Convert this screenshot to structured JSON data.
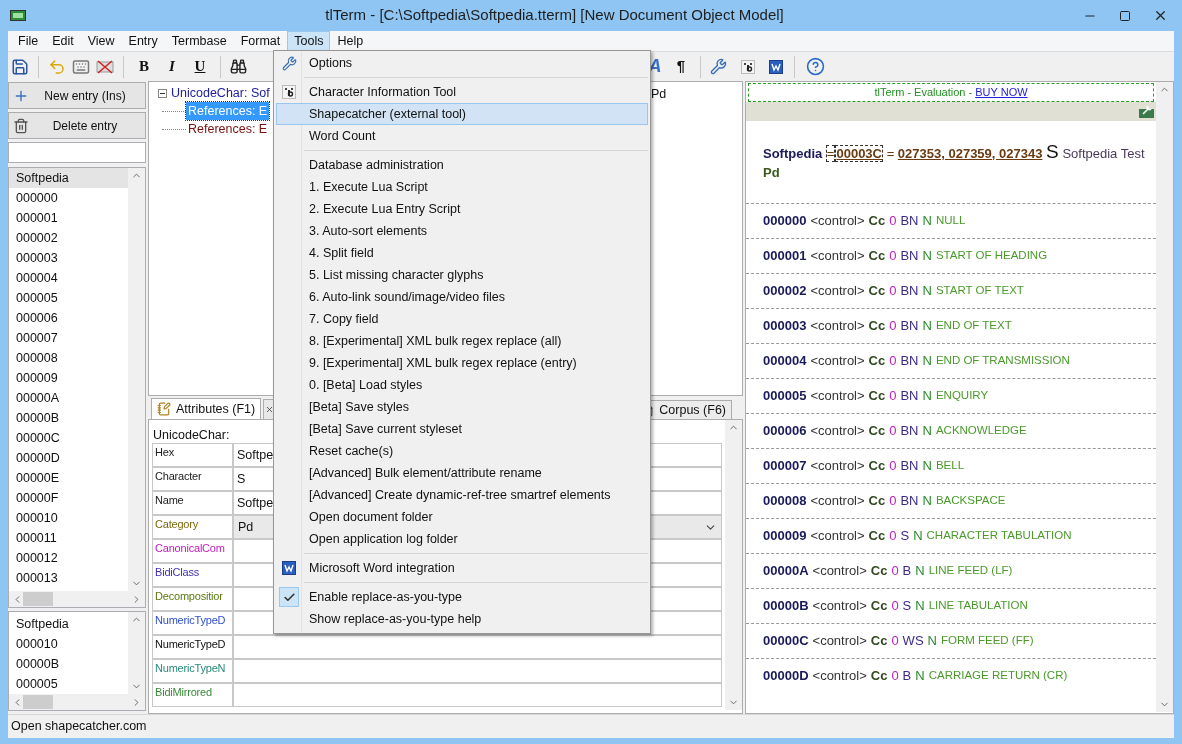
{
  "window": {
    "title": "tlTerm - [C:\\Softpedia\\Softpedia.tterm] [New Document Object Model]"
  },
  "menu_bar": [
    {
      "label": "File",
      "selected": false
    },
    {
      "label": "Edit",
      "selected": false
    },
    {
      "label": "View",
      "selected": false
    },
    {
      "label": "Entry",
      "selected": false
    },
    {
      "label": "Termbase",
      "selected": false
    },
    {
      "label": "Format",
      "selected": false
    },
    {
      "label": "Tools",
      "selected": true
    },
    {
      "label": "Help",
      "selected": false
    }
  ],
  "toolbar": {
    "format_buttons": [
      "B",
      "I",
      "U"
    ],
    "style_buttons": [
      "A",
      "¶"
    ]
  },
  "left_panel": {
    "buttons": [
      "New entry (Ins)",
      "Delete entry"
    ],
    "entries": [
      {
        "label": "Softpedia",
        "selected": true
      },
      {
        "label": "000000",
        "selected": false
      },
      {
        "label": "000001",
        "selected": false
      },
      {
        "label": "000002",
        "selected": false
      },
      {
        "label": "000003",
        "selected": false
      },
      {
        "label": "000004",
        "selected": false
      },
      {
        "label": "000005",
        "selected": false
      },
      {
        "label": "000006",
        "selected": false
      },
      {
        "label": "000007",
        "selected": false
      },
      {
        "label": "000008",
        "selected": false
      },
      {
        "label": "000009",
        "selected": false
      },
      {
        "label": "00000A",
        "selected": false
      },
      {
        "label": "00000B",
        "selected": false
      },
      {
        "label": "00000C",
        "selected": false
      },
      {
        "label": "00000D",
        "selected": false
      },
      {
        "label": "00000E",
        "selected": false
      },
      {
        "label": "00000F",
        "selected": false
      },
      {
        "label": "000010",
        "selected": false
      },
      {
        "label": "000011",
        "selected": false
      },
      {
        "label": "000012",
        "selected": false
      },
      {
        "label": "000013",
        "selected": false
      }
    ],
    "recent": [
      {
        "label": "Softpedia",
        "selected": false
      },
      {
        "label": "000010",
        "selected": false
      },
      {
        "label": "00000B",
        "selected": false
      },
      {
        "label": "000005",
        "selected": false
      }
    ]
  },
  "tree": {
    "root": {
      "label": "UnicodeChar: Sof",
      "expanded": true,
      "selected": false,
      "children": [
        {
          "label": "References:  E",
          "selected": true
        },
        {
          "label": "References:  E",
          "selected": false
        }
      ]
    },
    "tail": "Pd"
  },
  "tabs": [
    {
      "label": "Attributes (F1)",
      "selected": true
    },
    {
      "label": "Corpus (F6)",
      "selected": false
    }
  ],
  "attributes": {
    "title": "UnicodeChar:",
    "rows": [
      {
        "label": "Hex",
        "color": "#202020",
        "kind": "text",
        "value": "Softpe"
      },
      {
        "label": "Character",
        "color": "#202020",
        "kind": "text",
        "value": "S"
      },
      {
        "label": "Name",
        "color": "#202020",
        "kind": "text",
        "value": "Softpe"
      },
      {
        "label": "Category",
        "color": "#7a6a10",
        "kind": "dropdown",
        "value": "Pd"
      },
      {
        "label": "CanonicalCom",
        "color": "#c020c0",
        "kind": "text"
      },
      {
        "label": "BidiClass",
        "color": "#4030b0",
        "kind": "text"
      },
      {
        "label": "Decompositior",
        "color": "#5a7a10",
        "kind": "text"
      },
      {
        "label": "NumericTypeD",
        "color": "#3050d0",
        "kind": "text"
      },
      {
        "label": "NumericTypeD",
        "color": "#101010",
        "kind": "text"
      },
      {
        "label": "NumericTypeN",
        "color": "#2a8a7a",
        "kind": "text"
      },
      {
        "label": "BidiMirrored",
        "color": "#3a8a3a",
        "kind": "text"
      }
    ]
  },
  "preview": {
    "banner": "tlTerm - Evaluation - ",
    "banner_link": "BUY NOW",
    "header": {
      "name": "Softpedia",
      "eq1": "=",
      "code": "00003C",
      "eq2": "=",
      "refs": "027353, 027359, 027343",
      "char": "S",
      "description": "Softpedia Test",
      "category": "Pd"
    },
    "rows": [
      {
        "code": "000000",
        "type": "<control>",
        "category": "Cc",
        "combining": "0",
        "bidi": "BN",
        "mirrored": "N",
        "name": "NULL"
      },
      {
        "code": "000001",
        "type": "<control>",
        "category": "Cc",
        "combining": "0",
        "bidi": "BN",
        "mirrored": "N",
        "name": "START OF HEADING"
      },
      {
        "code": "000002",
        "type": "<control>",
        "category": "Cc",
        "combining": "0",
        "bidi": "BN",
        "mirrored": "N",
        "name": "START OF TEXT"
      },
      {
        "code": "000003",
        "type": "<control>",
        "category": "Cc",
        "combining": "0",
        "bidi": "BN",
        "mirrored": "N",
        "name": "END OF TEXT"
      },
      {
        "code": "000004",
        "type": "<control>",
        "category": "Cc",
        "combining": "0",
        "bidi": "BN",
        "mirrored": "N",
        "name": "END OF TRANSMISSION"
      },
      {
        "code": "000005",
        "type": "<control>",
        "category": "Cc",
        "combining": "0",
        "bidi": "BN",
        "mirrored": "N",
        "name": "ENQUIRY"
      },
      {
        "code": "000006",
        "type": "<control>",
        "category": "Cc",
        "combining": "0",
        "bidi": "BN",
        "mirrored": "N",
        "name": "ACKNOWLEDGE"
      },
      {
        "code": "000007",
        "type": "<control>",
        "category": "Cc",
        "combining": "0",
        "bidi": "BN",
        "mirrored": "N",
        "name": "BELL"
      },
      {
        "code": "000008",
        "type": "<control>",
        "category": "Cc",
        "combining": "0",
        "bidi": "BN",
        "mirrored": "N",
        "name": "BACKSPACE"
      },
      {
        "code": "000009",
        "type": "<control>",
        "category": "Cc",
        "combining": "0",
        "bidi": "S",
        "mirrored": "N",
        "name": "CHARACTER TABULATION"
      },
      {
        "code": "00000A",
        "type": "<control>",
        "category": "Cc",
        "combining": "0",
        "bidi": "B",
        "mirrored": "N",
        "name": "LINE FEED (LF)"
      },
      {
        "code": "00000B",
        "type": "<control>",
        "category": "Cc",
        "combining": "0",
        "bidi": "S",
        "mirrored": "N",
        "name": "LINE TABULATION"
      },
      {
        "code": "00000C",
        "type": "<control>",
        "category": "Cc",
        "combining": "0",
        "bidi": "WS",
        "mirrored": "N",
        "name": "FORM FEED (FF)"
      },
      {
        "code": "00000D",
        "type": "<control>",
        "category": "Cc",
        "combining": "0",
        "bidi": "B",
        "mirrored": "N",
        "name": "CARRIAGE RETURN (CR)"
      }
    ]
  },
  "tools_menu": [
    {
      "kind": "item",
      "label": "Options",
      "selected": false,
      "checked": false
    },
    {
      "kind": "separator"
    },
    {
      "kind": "item",
      "label": "Character Information Tool",
      "selected": false,
      "checked": false
    },
    {
      "kind": "item",
      "label": "Shapecatcher (external tool)",
      "selected": true,
      "checked": false
    },
    {
      "kind": "item",
      "label": "Word Count",
      "selected": false,
      "checked": false
    },
    {
      "kind": "separator"
    },
    {
      "kind": "item",
      "label": "Database administration",
      "selected": false,
      "checked": false
    },
    {
      "kind": "item",
      "label": "1. Execute Lua Script",
      "selected": false,
      "checked": false
    },
    {
      "kind": "item",
      "label": "2. Execute Lua Entry Script",
      "selected": false,
      "checked": false
    },
    {
      "kind": "item",
      "label": "3. Auto-sort elements",
      "selected": false,
      "checked": false
    },
    {
      "kind": "item",
      "label": "4. Split field",
      "selected": false,
      "checked": false
    },
    {
      "kind": "item",
      "label": "5. List missing character glyphs",
      "selected": false,
      "checked": false
    },
    {
      "kind": "item",
      "label": "6. Auto-link sound/image/video files",
      "selected": false,
      "checked": false
    },
    {
      "kind": "item",
      "label": "7. Copy field",
      "selected": false,
      "checked": false
    },
    {
      "kind": "item",
      "label": "8. [Experimental] XML bulk regex replace (all)",
      "selected": false,
      "checked": false
    },
    {
      "kind": "item",
      "label": "9. [Experimental] XML bulk regex replace (entry)",
      "selected": false,
      "checked": false
    },
    {
      "kind": "item",
      "label": "0. [Beta] Load styles",
      "selected": false,
      "checked": false
    },
    {
      "kind": "item",
      "label": "[Beta] Save styles",
      "selected": false,
      "checked": false
    },
    {
      "kind": "item",
      "label": "[Beta] Save current styleset",
      "selected": false,
      "checked": false
    },
    {
      "kind": "item",
      "label": "Reset cache(s)",
      "selected": false,
      "checked": false
    },
    {
      "kind": "item",
      "label": "[Advanced] Bulk element/attribute rename",
      "selected": false,
      "checked": false
    },
    {
      "kind": "item",
      "label": "[Advanced] Create dynamic-ref-tree smartref elements",
      "selected": false,
      "checked": false
    },
    {
      "kind": "item",
      "label": "Open document folder",
      "selected": false,
      "checked": false
    },
    {
      "kind": "item",
      "label": "Open application log folder",
      "selected": false,
      "checked": false
    },
    {
      "kind": "separator"
    },
    {
      "kind": "item",
      "label": "Microsoft Word integration",
      "selected": false,
      "checked": false
    },
    {
      "kind": "separator"
    },
    {
      "kind": "item",
      "label": "Enable replace-as-you-type",
      "selected": false,
      "checked": true
    },
    {
      "kind": "item",
      "label": "Show replace-as-you-type help",
      "selected": false,
      "checked": false
    }
  ],
  "status_bar": "Open shapecatcher.com"
}
